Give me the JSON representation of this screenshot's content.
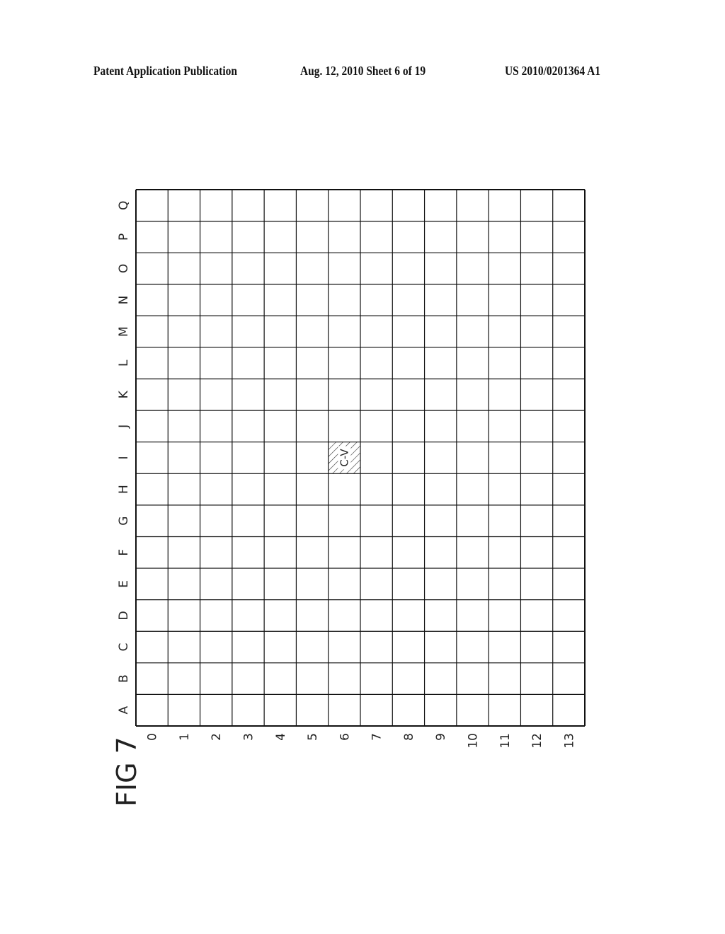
{
  "header": {
    "left": "Patent Application Publication",
    "middle": "Aug. 12, 2010  Sheet 6 of 19",
    "right": "US 2010/0201364 A1"
  },
  "figure": {
    "label": "FIG 7",
    "orientation": "rotated 90 degrees counter-clockwise",
    "columns": [
      "0",
      "1",
      "2",
      "3",
      "4",
      "5",
      "6",
      "7",
      "8",
      "9",
      "10",
      "11",
      "12",
      "13"
    ],
    "rows": [
      "A",
      "B",
      "C",
      "D",
      "E",
      "F",
      "G",
      "H",
      "I",
      "J",
      "K",
      "L",
      "M",
      "N",
      "O",
      "P",
      "Q"
    ],
    "highlighted_cells": [
      {
        "column": "6",
        "row": "I",
        "label": "C-V",
        "fill": "hatched"
      }
    ]
  },
  "chart_data": {
    "type": "heatmap",
    "title": "FIG 7",
    "x": [
      "0",
      "1",
      "2",
      "3",
      "4",
      "5",
      "6",
      "7",
      "8",
      "9",
      "10",
      "11",
      "12",
      "13"
    ],
    "y": [
      "A",
      "B",
      "C",
      "D",
      "E",
      "F",
      "G",
      "H",
      "I",
      "J",
      "K",
      "L",
      "M",
      "N",
      "O",
      "P",
      "Q"
    ],
    "marked": [
      {
        "x": "6",
        "y": "I",
        "label": "C-V"
      }
    ],
    "grid": true
  }
}
